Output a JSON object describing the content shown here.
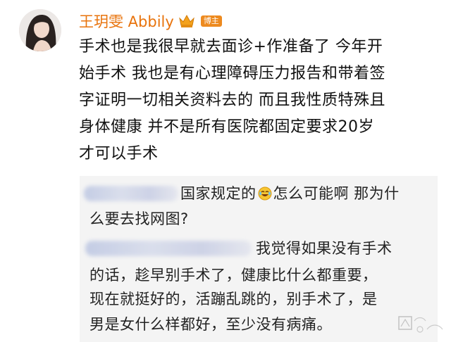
{
  "post": {
    "author": {
      "name": "王玥雯 Abbily",
      "badge_label": "博主"
    },
    "lines": [
      "手术也是我很早就去面诊+作准备了  今年开",
      "始手术  我也是有心理障碍压力报告和带着签",
      "字证明一切相关资料去的  而且我性质特殊且",
      "身体健康  并不是所有医院都固定要求20岁",
      "才可以手术"
    ]
  },
  "replies": [
    {
      "text_line1": "国家规定的",
      "text_line1_after_emoji": "怎么可能啊  那为什",
      "text_line2": "么要去找网图?"
    },
    {
      "text_line1": "我觉得如果没有手术",
      "text_line2": "的话，趁早别手术了，健康比什么都重要，",
      "text_line3": "现在就挺好的，活蹦乱跳的，别手术了，是",
      "text_line4": "男是女什么样都好，至少没有病痛。"
    }
  ],
  "icons": {
    "emoji": "laughing-crying-emoji",
    "crown": "crown-icon"
  },
  "colors": {
    "username": "#e8730c",
    "badge_bg": "#ed8a1f",
    "reply_bg": "#f4f4f4"
  }
}
